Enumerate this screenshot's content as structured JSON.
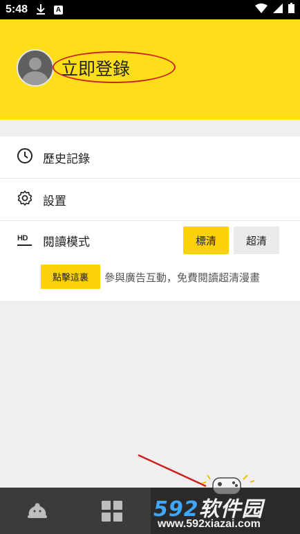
{
  "status_bar": {
    "time": "5:48",
    "icons": [
      "download-icon",
      "a-icon",
      "wifi-icon",
      "signal-icon",
      "battery-icon"
    ]
  },
  "header": {
    "login_label": "立即登錄",
    "background_color": "#fedd1a",
    "annotation_color": "#cc2020"
  },
  "menu": {
    "history_label": "歷史記錄",
    "settings_label": "設置",
    "reading_mode": {
      "label": "閱讀模式",
      "icon_text": "HD",
      "options": [
        "標清",
        "超清"
      ],
      "selected": "標清"
    },
    "promo": {
      "button_label": "點擊這裏",
      "text": "參與廣告互動，免費閱讀超清漫畫"
    }
  },
  "bottom_nav": {
    "items": [
      "home-icon",
      "category-grid-icon",
      "game-icon"
    ]
  },
  "watermark": {
    "number": "592",
    "brand": "软件园",
    "url": "www.592xiazai.com"
  },
  "colors": {
    "accent": "#fdd20a",
    "nav_bg": "#3b3b3b",
    "page_bg": "#efefef"
  }
}
